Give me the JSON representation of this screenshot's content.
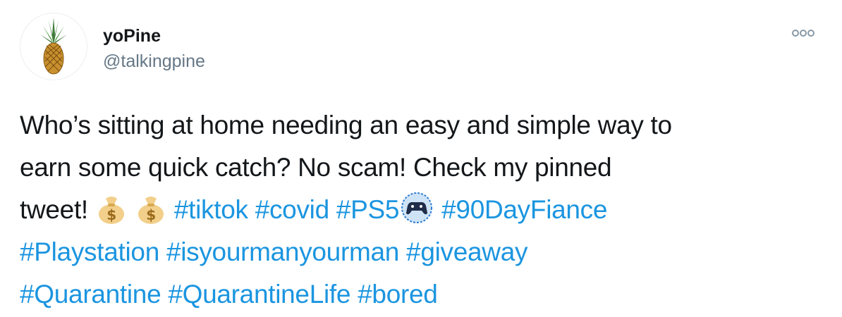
{
  "tweet": {
    "display_name": "yoPine",
    "handle": "@talkingpine",
    "text_line1": "Who’s sitting at home needing an easy and simple way to",
    "text_line2": "earn some quick catch? No scam! Check my pinned",
    "text_line3_prefix": "tweet! ",
    "hashtags": {
      "tiktok": "#tiktok",
      "covid": "#covid",
      "ps5": "#PS5",
      "ninety_day_fiance": "#90DayFiance",
      "playstation": "#Playstation",
      "isyourmanyourman": "#isyourmanyourman",
      "giveaway": "#giveaway",
      "quarantine": "#Quarantine",
      "quarantinelife": "#QuarantineLife",
      "bored": "#bored"
    },
    "icons": {
      "avatar": "pineapple-icon",
      "more": "more-options-icon",
      "emoji_1": "money-bag-icon",
      "emoji_2": "money-bag-icon",
      "emoji_3": "game-controller-icon"
    }
  },
  "colors": {
    "hashtag": "#1b95e0",
    "handle": "#657786",
    "text": "#14171a",
    "more_icon": "#8899a6"
  }
}
